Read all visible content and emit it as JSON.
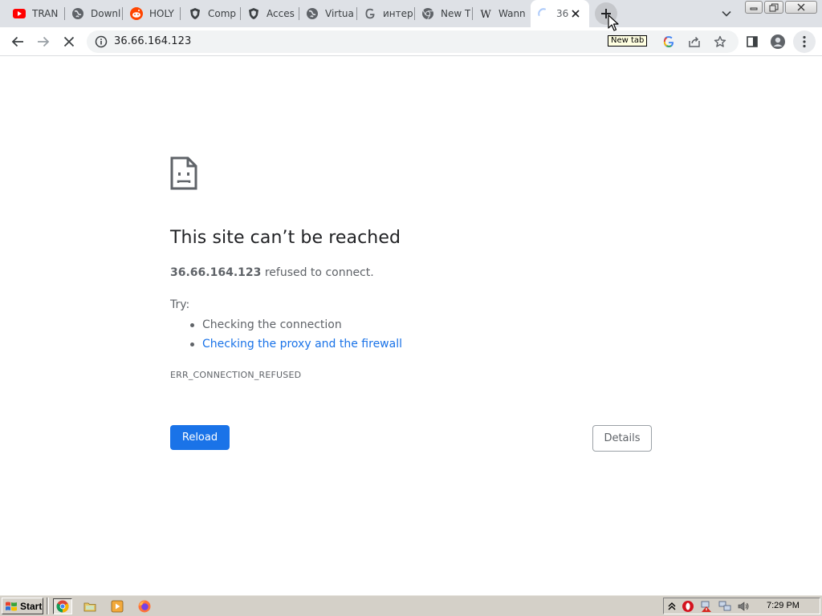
{
  "browser": {
    "tabs": [
      {
        "title": "TRAN",
        "favicon": "youtube-icon",
        "active": false
      },
      {
        "title": "Downl",
        "favicon": "globe-icon",
        "active": false
      },
      {
        "title": "HOLY",
        "favicon": "reddit-icon",
        "active": false
      },
      {
        "title": "Comp",
        "favicon": "shield-icon",
        "active": false
      },
      {
        "title": "Acces",
        "favicon": "shield-icon",
        "active": false
      },
      {
        "title": "Virtua",
        "favicon": "globe-icon",
        "active": false
      },
      {
        "title": "интер",
        "favicon": "google-icon",
        "active": false
      },
      {
        "title": "New T",
        "favicon": "chrome-icon",
        "active": false
      },
      {
        "title": "Wann",
        "favicon": "wikipedia-icon",
        "active": false
      },
      {
        "title": "36",
        "favicon": "loading-spinner-icon",
        "active": true
      }
    ],
    "new_tab_tooltip": "New tab",
    "address_bar": {
      "url": "36.66.164.123"
    },
    "colors": {
      "tabstrip_bg": "#dee1e6",
      "omnibox_bg": "#f1f3f4",
      "accent": "#1a73e8"
    }
  },
  "error_page": {
    "icon": "sad-document-icon",
    "title": "This site can’t be reached",
    "host": "36.66.164.123",
    "message": " refused to connect.",
    "try_label": "Try:",
    "suggestions": [
      {
        "text": "Checking the connection",
        "is_link": false
      },
      {
        "text": "Checking the proxy and the firewall",
        "is_link": true
      }
    ],
    "error_code": "ERR_CONNECTION_REFUSED",
    "reload_label": "Reload",
    "details_label": "Details"
  },
  "taskbar": {
    "start_label": "Start",
    "quick_launch": [
      "chrome-icon",
      "folder-icon",
      "media-player-icon"
    ],
    "running": [
      "firefox-icon"
    ],
    "tray_icons": [
      "show-hidden-icon",
      "opera-icon",
      "network-warning-icon",
      "network-icon",
      "volume-icon"
    ],
    "clock": "7:29 PM"
  }
}
